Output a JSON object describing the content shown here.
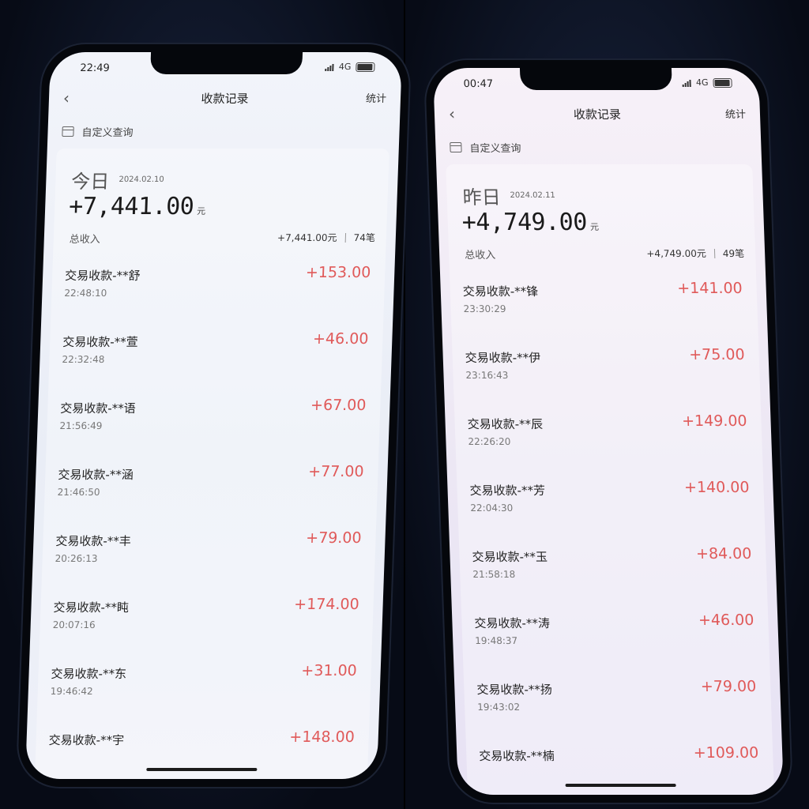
{
  "left": {
    "status_time": "22:49",
    "network": "4G",
    "nav_title": "收款记录",
    "nav_stats": "统计",
    "query_label": "自定义查询",
    "day_label": "今日",
    "day_date": "2024.02.10",
    "total_amount": "+7,441.00",
    "currency_unit": "元",
    "income_label": "总收入",
    "summary_amount": "+7,441.00元",
    "summary_count": "74笔",
    "transactions": [
      {
        "title": "交易收款-**舒",
        "time": "22:48:10",
        "amount": "+153.00"
      },
      {
        "title": "交易收款-**萱",
        "time": "22:32:48",
        "amount": "+46.00"
      },
      {
        "title": "交易收款-**语",
        "time": "21:56:49",
        "amount": "+67.00"
      },
      {
        "title": "交易收款-**涵",
        "time": "21:46:50",
        "amount": "+77.00"
      },
      {
        "title": "交易收款-**丰",
        "time": "20:26:13",
        "amount": "+79.00"
      },
      {
        "title": "交易收款-**盹",
        "time": "20:07:16",
        "amount": "+174.00"
      },
      {
        "title": "交易收款-**东",
        "time": "19:46:42",
        "amount": "+31.00"
      },
      {
        "title": "交易收款-**宇",
        "time": "",
        "amount": "+148.00"
      }
    ]
  },
  "right": {
    "status_time": "00:47",
    "network": "4G",
    "nav_title": "收款记录",
    "nav_stats": "统计",
    "query_label": "自定义查询",
    "day_label": "昨日",
    "day_date": "2024.02.11",
    "total_amount": "+4,749.00",
    "currency_unit": "元",
    "income_label": "总收入",
    "summary_amount": "+4,749.00元",
    "summary_count": "49笔",
    "transactions": [
      {
        "title": "交易收款-**锋",
        "time": "23:30:29",
        "amount": "+141.00"
      },
      {
        "title": "交易收款-**伊",
        "time": "23:16:43",
        "amount": "+75.00"
      },
      {
        "title": "交易收款-**辰",
        "time": "22:26:20",
        "amount": "+149.00"
      },
      {
        "title": "交易收款-**芳",
        "time": "22:04:30",
        "amount": "+140.00"
      },
      {
        "title": "交易收款-**玉",
        "time": "21:58:18",
        "amount": "+84.00"
      },
      {
        "title": "交易收款-**涛",
        "time": "19:48:37",
        "amount": "+46.00"
      },
      {
        "title": "交易收款-**扬",
        "time": "19:43:02",
        "amount": "+79.00"
      },
      {
        "title": "交易收款-**楠",
        "time": "",
        "amount": "+109.00"
      }
    ]
  }
}
